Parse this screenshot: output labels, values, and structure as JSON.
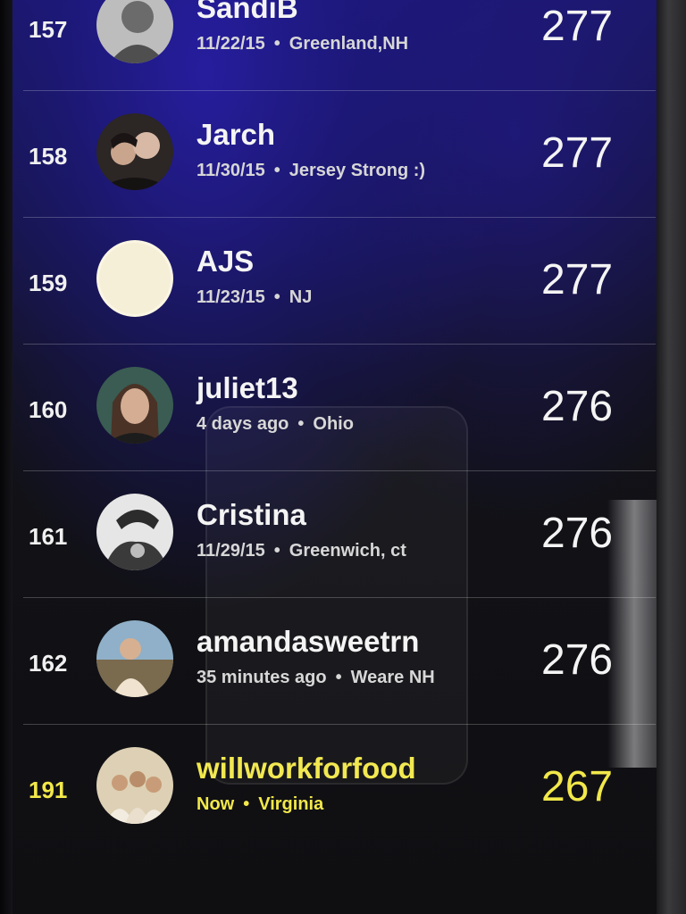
{
  "leaderboard": {
    "rows": [
      {
        "rank": "157",
        "name": "SandiB",
        "date": "11/22/15",
        "location": "Greenland,NH",
        "score": "277",
        "avatar_colors": [
          "#cfcfcf",
          "#6e6e6e"
        ]
      },
      {
        "rank": "158",
        "name": "Jarch",
        "date": "11/30/15",
        "location": "Jersey Strong :)",
        "score": "277",
        "avatar_colors": [
          "#d8b9a6",
          "#2a2422"
        ]
      },
      {
        "rank": "159",
        "name": "AJS",
        "date": "11/23/15",
        "location": "NJ",
        "score": "277",
        "avatar_colors": [
          "#fbf6e3",
          "#f2ebd2"
        ]
      },
      {
        "rank": "160",
        "name": "juliet13",
        "date": "4 days ago",
        "location": "Ohio",
        "score": "276",
        "avatar_colors": [
          "#c9a48c",
          "#3a5c52"
        ]
      },
      {
        "rank": "161",
        "name": "Cristina",
        "date": "11/29/15",
        "location": "Greenwich, ct",
        "score": "276",
        "avatar_colors": [
          "#e8e8e8",
          "#3c3c3c"
        ]
      },
      {
        "rank": "162",
        "name": "amandasweetrn",
        "date": "35 minutes ago",
        "location": "Weare NH",
        "score": "276",
        "avatar_colors": [
          "#e6c9a8",
          "#5d7d9a"
        ]
      },
      {
        "rank": "191",
        "name": "willworkforfood",
        "date": "Now",
        "location": "Virginia",
        "score": "267",
        "highlight": true,
        "avatar_colors": [
          "#e9dcc1",
          "#b58f6a"
        ]
      }
    ],
    "highlight_color": "#f2e84a",
    "text_color": "#f4f4f4"
  }
}
